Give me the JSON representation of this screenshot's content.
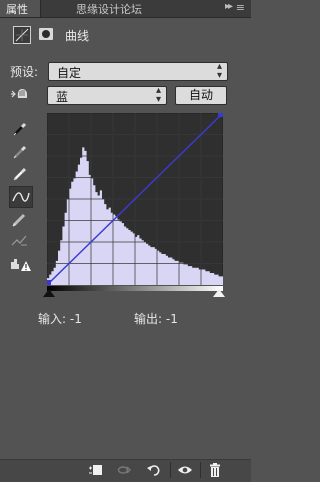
{
  "panel": {
    "tab_label": "属性",
    "watermark": "思缘设计论坛"
  },
  "header": {
    "title": "曲线"
  },
  "preset": {
    "label": "预设:",
    "value": "自定"
  },
  "channel": {
    "value": "蓝",
    "auto_label": "自动"
  },
  "readouts": {
    "input_label": "输入:",
    "input_value": "-1",
    "output_label": "输出:",
    "output_value": "-1"
  },
  "colors": {
    "panel_bg": "#535353",
    "graph_bg": "#2f2f2f",
    "histogram_fill": "#d8d6f4",
    "curve_color": "#3a3ad2",
    "baseline_color": "#6a6ab0"
  },
  "histogram_levels": [
    0.04,
    0.06,
    0.08,
    0.1,
    0.14,
    0.2,
    0.26,
    0.34,
    0.42,
    0.5,
    0.56,
    0.6,
    0.62,
    0.66,
    0.7,
    0.74,
    0.8,
    0.78,
    0.72,
    0.64,
    0.62,
    0.58,
    0.54,
    0.52,
    0.55,
    0.5,
    0.47,
    0.44,
    0.45,
    0.42,
    0.41,
    0.4,
    0.38,
    0.37,
    0.36,
    0.34,
    0.33,
    0.32,
    0.31,
    0.3,
    0.28,
    0.29,
    0.27,
    0.26,
    0.25,
    0.24,
    0.23,
    0.22,
    0.22,
    0.21,
    0.2,
    0.19,
    0.18,
    0.18,
    0.17,
    0.16,
    0.16,
    0.15,
    0.14,
    0.14,
    0.13,
    0.13,
    0.12,
    0.12,
    0.11,
    0.11,
    0.1,
    0.1,
    0.1,
    0.09,
    0.09,
    0.09,
    0.08,
    0.08,
    0.07,
    0.07,
    0.06,
    0.06,
    0.05,
    0.05
  ],
  "curve": {
    "points": [
      [
        0,
        0
      ],
      [
        255,
        255
      ]
    ]
  }
}
